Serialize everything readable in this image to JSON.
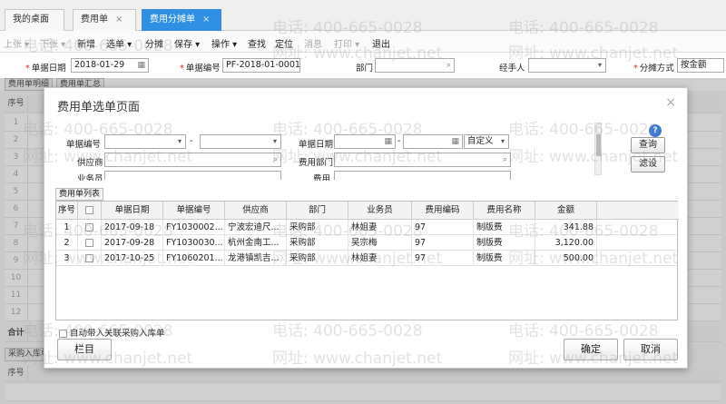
{
  "tabs": [
    {
      "label": "我的桌面",
      "closable": false,
      "active": false
    },
    {
      "label": "费用单",
      "closable": true,
      "active": false
    },
    {
      "label": "费用分摊单",
      "closable": true,
      "active": true
    }
  ],
  "toolbar": {
    "items": [
      {
        "label": "上张 ▾",
        "enabled": false
      },
      {
        "label": "下张 ▾",
        "enabled": false
      },
      {
        "label": "新增",
        "enabled": true
      },
      {
        "label": "选单 ▾",
        "enabled": true
      },
      {
        "label": "分摊",
        "enabled": true
      },
      {
        "label": "保存 ▾",
        "enabled": true
      },
      {
        "label": "操作 ▾",
        "enabled": true
      },
      {
        "label": "查找",
        "enabled": true
      },
      {
        "label": "定位",
        "enabled": true
      },
      {
        "label": "消息",
        "enabled": false
      },
      {
        "label": "打印 ▾",
        "enabled": false
      },
      {
        "label": "退出",
        "enabled": true
      }
    ]
  },
  "header_form": {
    "doc_date_label": "单据日期",
    "doc_date_value": "2018-01-29",
    "doc_no_label": "单据编号",
    "doc_no_value": "PF-2018-01-0001",
    "dept_label": "部门",
    "handler_label": "经手人",
    "alloc_method_label": "分摊方式",
    "alloc_method_value": "按金额"
  },
  "sub_tabs": {
    "detail": "费用单明细",
    "summary": "费用单汇总"
  },
  "background": {
    "seq_header": "序号",
    "row_numbers": [
      "1",
      "2",
      "3",
      "4",
      "5",
      "6",
      "7",
      "8",
      "9",
      "10",
      "11",
      "12"
    ],
    "total_label": "合计",
    "purchase_tab": "采购入库单",
    "seq_header2": "序号"
  },
  "watermark": {
    "phone": "电话: 400-665-0028",
    "site": "网址: www.chanjet.net"
  },
  "modal": {
    "title": "费用单选单页面",
    "close": "×",
    "filters": {
      "doc_no_label": "单据编号",
      "doc_no_sep": "-",
      "supplier_label": "供应商",
      "salesman_label": "业务员",
      "doc_date_label": "单据日期",
      "doc_date_sep": "-",
      "date_range_value": "自定义",
      "expense_dept_label": "费用部门",
      "expense_label": "费用"
    },
    "query_button": "查询",
    "filter_button": "滤设",
    "list_tab": "费用单列表",
    "columns": [
      "序号",
      "",
      "单据日期",
      "单据编号",
      "供应商",
      "部门",
      "业务员",
      "费用编码",
      "费用名称",
      "金额"
    ],
    "rows": [
      {
        "seq": "1",
        "date": "2017-09-18",
        "no": "FY1030002...",
        "supplier": "宁波宏迪尺...",
        "dept": "采购部",
        "salesman": "林姐妻",
        "fee_code": "97",
        "fee_name": "制版费",
        "amount": "341.88"
      },
      {
        "seq": "2",
        "date": "2017-09-28",
        "no": "FY1030030...",
        "supplier": "杭州金南工...",
        "dept": "采购部",
        "salesman": "吴宗梅",
        "fee_code": "97",
        "fee_name": "制版费",
        "amount": "3,120.00"
      },
      {
        "seq": "3",
        "date": "2017-10-25",
        "no": "FY1060201...",
        "supplier": "龙港镇凯吉...",
        "dept": "采购部",
        "salesman": "林姐妻",
        "fee_code": "97",
        "fee_name": "制版费",
        "amount": "500.00"
      }
    ],
    "auto_link_label": "自动带入关联采购入库单",
    "columns_button": "栏目",
    "ok_button": "确定",
    "cancel_button": "取消"
  }
}
